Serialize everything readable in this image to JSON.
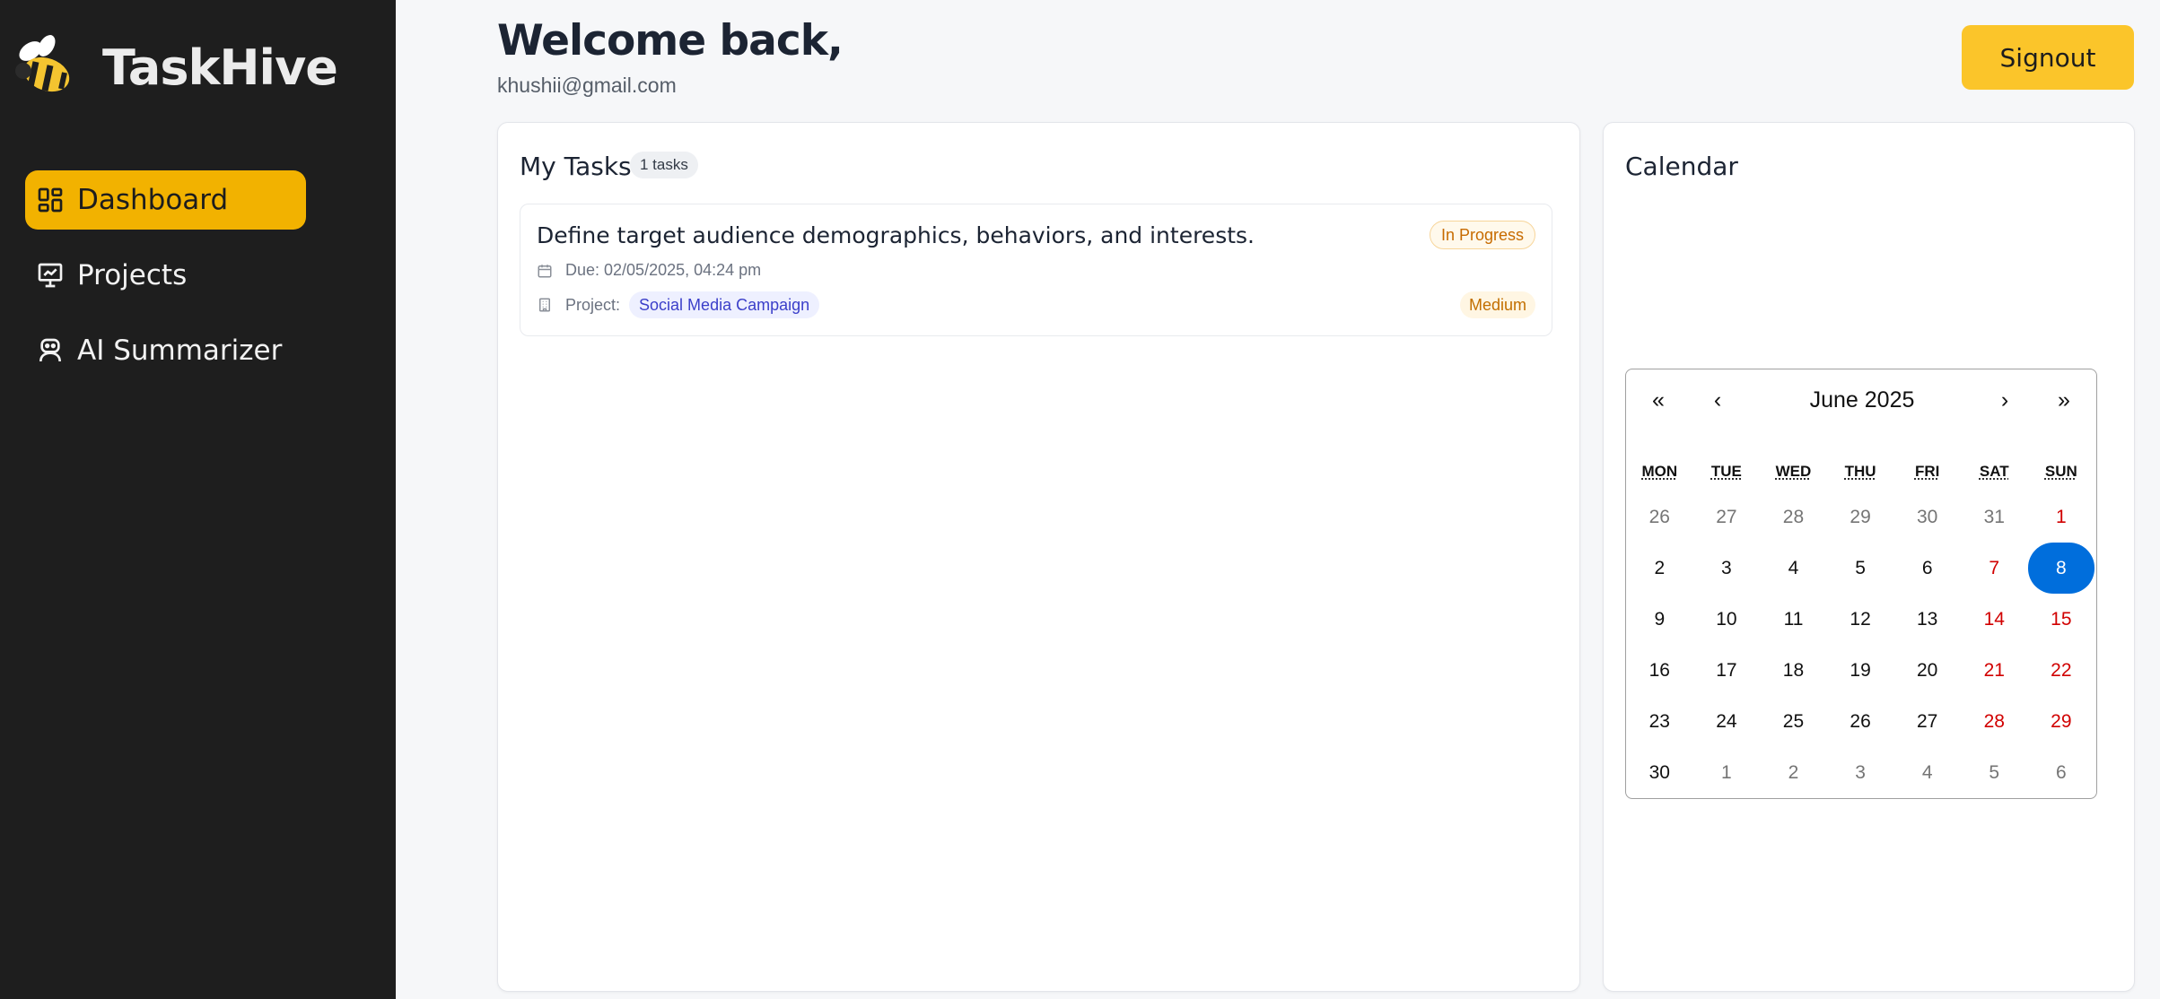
{
  "app": {
    "name": "TaskHive"
  },
  "nav": {
    "items": [
      {
        "label": "Dashboard",
        "icon": "dashboard-grid-icon",
        "active": true
      },
      {
        "label": "Projects",
        "icon": "presentation-chart-icon",
        "active": false
      },
      {
        "label": "AI Summarizer",
        "icon": "robot-icon",
        "active": false
      }
    ]
  },
  "header": {
    "welcome": "Welcome back,",
    "email": "khushii@gmail.com",
    "signout_label": "Signout"
  },
  "tasks": {
    "title": "My Tasks",
    "count_label": "1 tasks",
    "items": [
      {
        "title": "Define target audience demographics, behaviors, and interests.",
        "status": "In Progress",
        "due": "Due: 02/05/2025, 04:24 pm",
        "project_label": "Project:",
        "project": "Social Media Campaign",
        "priority": "Medium"
      }
    ]
  },
  "calendar": {
    "title": "Calendar",
    "month_label": "June 2025",
    "nav": {
      "prev_year": "«",
      "prev": "‹",
      "next": "›",
      "next_year": "»"
    },
    "weekdays": [
      "MON",
      "TUE",
      "WED",
      "THU",
      "FRI",
      "SAT",
      "SUN"
    ],
    "selected_day": "8",
    "weeks": [
      [
        "26",
        "27",
        "28",
        "29",
        "30",
        "31",
        "1"
      ],
      [
        "2",
        "3",
        "4",
        "5",
        "6",
        "7",
        "8"
      ],
      [
        "9",
        "10",
        "11",
        "12",
        "13",
        "14",
        "15"
      ],
      [
        "16",
        "17",
        "18",
        "19",
        "20",
        "21",
        "22"
      ],
      [
        "23",
        "24",
        "25",
        "26",
        "27",
        "28",
        "29"
      ],
      [
        "30",
        "1",
        "2",
        "3",
        "4",
        "5",
        "6"
      ]
    ]
  },
  "colors": {
    "sidebar_bg": "#1e1e1e",
    "accent": "#f2b200",
    "signout_bg": "#fbc52a",
    "selected_day": "#006edc",
    "weekend": "#d10000"
  }
}
